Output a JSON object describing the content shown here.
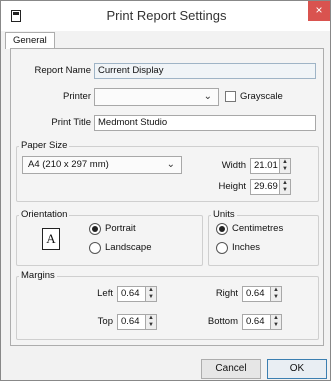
{
  "window": {
    "title": "Print Report Settings",
    "close_glyph": "×"
  },
  "tabs": [
    {
      "label": "General"
    }
  ],
  "report_name": {
    "label": "Report Name",
    "value": "Current Display"
  },
  "printer": {
    "label": "Printer",
    "value": "",
    "grayscale_label": "Grayscale",
    "grayscale_checked": false
  },
  "print_title": {
    "label": "Print Title",
    "value": "Medmont Studio"
  },
  "paper_size": {
    "group_label": "Paper Size",
    "selected": "A4 (210 x 297 mm)",
    "width_label": "Width",
    "width": "21.01",
    "height_label": "Height",
    "height": "29.69"
  },
  "orientation": {
    "group_label": "Orientation",
    "icon_glyph": "A",
    "portrait_label": "Portrait",
    "landscape_label": "Landscape",
    "selected": "Portrait"
  },
  "units": {
    "group_label": "Units",
    "centimetres_label": "Centimetres",
    "inches_label": "Inches",
    "selected": "Centimetres"
  },
  "margins": {
    "group_label": "Margins",
    "left_label": "Left",
    "left": "0.64",
    "right_label": "Right",
    "right": "0.64",
    "top_label": "Top",
    "top": "0.64",
    "bottom_label": "Bottom",
    "bottom": "0.64"
  },
  "buttons": {
    "cancel": "Cancel",
    "ok": "OK"
  },
  "icons": {
    "spin_up": "▲",
    "spin_down": "▼",
    "chevron": "⌄"
  }
}
